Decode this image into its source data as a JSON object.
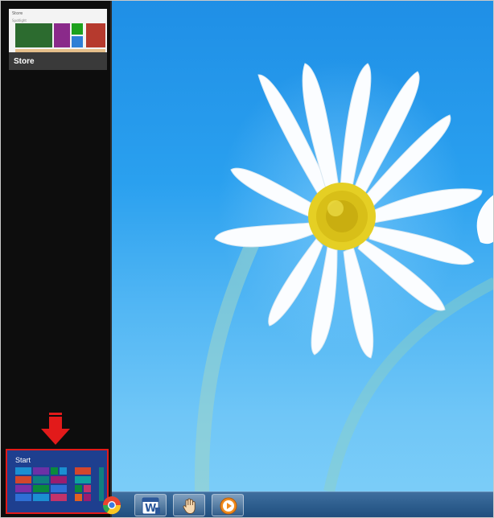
{
  "switcher": {
    "apps": [
      {
        "label": "Store",
        "icon": "store-app-thumbnail"
      },
      {
        "label": "Start",
        "icon": "start-screen-thumbnail"
      }
    ],
    "indicator": "red-down-arrow-icon",
    "highlight_color": "#e21a1a",
    "panel_color": "#0d0d0d"
  },
  "store_preview": {
    "header": "Store",
    "subheader": "Spotlight",
    "tile_colors": [
      "#2c6b2f",
      "#8a2a8a",
      "#1da11d",
      "#b63a2e",
      "#2f7fd6",
      "#d88a22"
    ]
  },
  "start_preview": {
    "background": "#1e3f8f",
    "tile_colors": [
      "#1b8fd1",
      "#6c31a6",
      "#0a8a3c",
      "#d2462c",
      "#0f7f7f",
      "#9b1d6f",
      "#2f6fd6",
      "#0fa0a0",
      "#7b2fa6",
      "#0a8a3c",
      "#c2336a",
      "#e06020"
    ]
  },
  "taskbar": {
    "items": [
      {
        "name": "chrome-icon",
        "active": false
      },
      {
        "name": "word-icon",
        "label": "W",
        "active": false
      },
      {
        "name": "hand-tool-icon",
        "active": true
      },
      {
        "name": "media-player-icon",
        "active": true
      }
    ]
  },
  "wallpaper": {
    "subject": "daisy-flower",
    "sky_color": "#2aa0ef",
    "petal_color": "#ffffff",
    "center_color": "#d8c21a"
  }
}
